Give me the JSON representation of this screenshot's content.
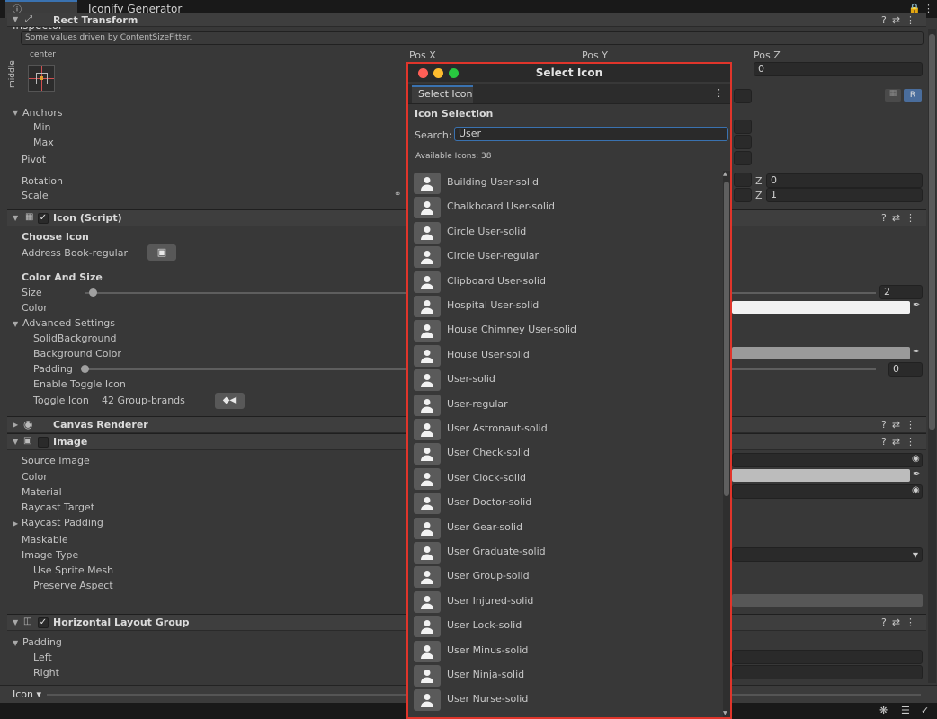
{
  "tabs": [
    {
      "label": "Inspector",
      "icon": "info-icon"
    },
    {
      "label": "Iconify Generator"
    }
  ],
  "rect_transform": {
    "title": "Rect Transform",
    "note": "Some values driven by ContentSizeFitter.",
    "anchor_preset_top": "center",
    "anchor_preset_side": "middle",
    "pos_x_label": "Pos X",
    "pos_y_label": "Pos Y",
    "pos_z_label": "Pos Z",
    "pos_z_value": "0",
    "anchors_label": "Anchors",
    "min_label": "Min",
    "max_label": "Max",
    "pivot_label": "Pivot",
    "rotation_label": "Rotation",
    "scale_label": "Scale",
    "z_label": "Z",
    "rotation_z": "0",
    "scale_z": "1",
    "r_button": "R"
  },
  "icon_script": {
    "title": "Icon (Script)",
    "choose_icon_label": "Choose Icon",
    "selected_icon": "Address Book-regular",
    "color_and_size_label": "Color And Size",
    "size_label": "Size",
    "size_value": "2",
    "color_label": "Color",
    "advanced_settings_label": "Advanced Settings",
    "solid_background_label": "SolidBackground",
    "background_color_label": "Background Color",
    "padding_label": "Padding",
    "padding_value": "0",
    "enable_toggle_icon_label": "Enable Toggle Icon",
    "toggle_icon_label": "Toggle Icon",
    "toggle_icon_value": "42 Group-brands"
  },
  "canvas_renderer": {
    "title": "Canvas Renderer"
  },
  "image": {
    "title": "Image",
    "source_image_label": "Source Image",
    "color_label": "Color",
    "material_label": "Material",
    "raycast_target_label": "Raycast Target",
    "raycast_padding_label": "Raycast Padding",
    "maskable_label": "Maskable",
    "image_type_label": "Image Type",
    "use_sprite_mesh_label": "Use Sprite Mesh",
    "preserve_aspect_label": "Preserve Aspect"
  },
  "horizontal_layout": {
    "title": "Horizontal Layout Group",
    "padding_label": "Padding",
    "left_label": "Left",
    "right_label": "Right"
  },
  "footer": {
    "object_label": "Icon ▾"
  },
  "modal": {
    "title": "Select Icon",
    "tab_label": "Select Icon",
    "section_label": "Icon Selection",
    "search_label": "Search:",
    "search_value": "User",
    "available_text": "Available Icons: 38",
    "icons": [
      {
        "name": "Building User-solid",
        "icon": "building-user-icon"
      },
      {
        "name": "Chalkboard User-solid",
        "icon": "chalkboard-user-icon"
      },
      {
        "name": "Circle User-solid",
        "icon": "circle-user-icon"
      },
      {
        "name": "Circle User-regular",
        "icon": "circle-user-outline-icon"
      },
      {
        "name": "Clipboard User-solid",
        "icon": "clipboard-user-icon"
      },
      {
        "name": "Hospital User-solid",
        "icon": "hospital-user-icon"
      },
      {
        "name": "House Chimney User-solid",
        "icon": "house-chimney-user-icon"
      },
      {
        "name": "House User-solid",
        "icon": "house-user-icon"
      },
      {
        "name": "User-solid",
        "icon": "user-icon"
      },
      {
        "name": "User-regular",
        "icon": "user-outline-icon"
      },
      {
        "name": "User Astronaut-solid",
        "icon": "user-astronaut-icon"
      },
      {
        "name": "User Check-solid",
        "icon": "user-check-icon"
      },
      {
        "name": "User Clock-solid",
        "icon": "user-clock-icon"
      },
      {
        "name": "User Doctor-solid",
        "icon": "user-doctor-icon"
      },
      {
        "name": "User Gear-solid",
        "icon": "user-gear-icon"
      },
      {
        "name": "User Graduate-solid",
        "icon": "user-graduate-icon"
      },
      {
        "name": "User Group-solid",
        "icon": "user-group-icon"
      },
      {
        "name": "User Injured-solid",
        "icon": "user-injured-icon"
      },
      {
        "name": "User Lock-solid",
        "icon": "user-lock-icon"
      },
      {
        "name": "User Minus-solid",
        "icon": "user-minus-icon"
      },
      {
        "name": "User Ninja-solid",
        "icon": "user-ninja-icon"
      },
      {
        "name": "User Nurse-solid",
        "icon": "user-nurse-icon"
      }
    ]
  },
  "colors": {
    "accent": "#3a72b0",
    "highlight_border": "#e0352b",
    "mac_red": "#ff5f57",
    "mac_yellow": "#febc2e",
    "mac_green": "#28c840"
  }
}
